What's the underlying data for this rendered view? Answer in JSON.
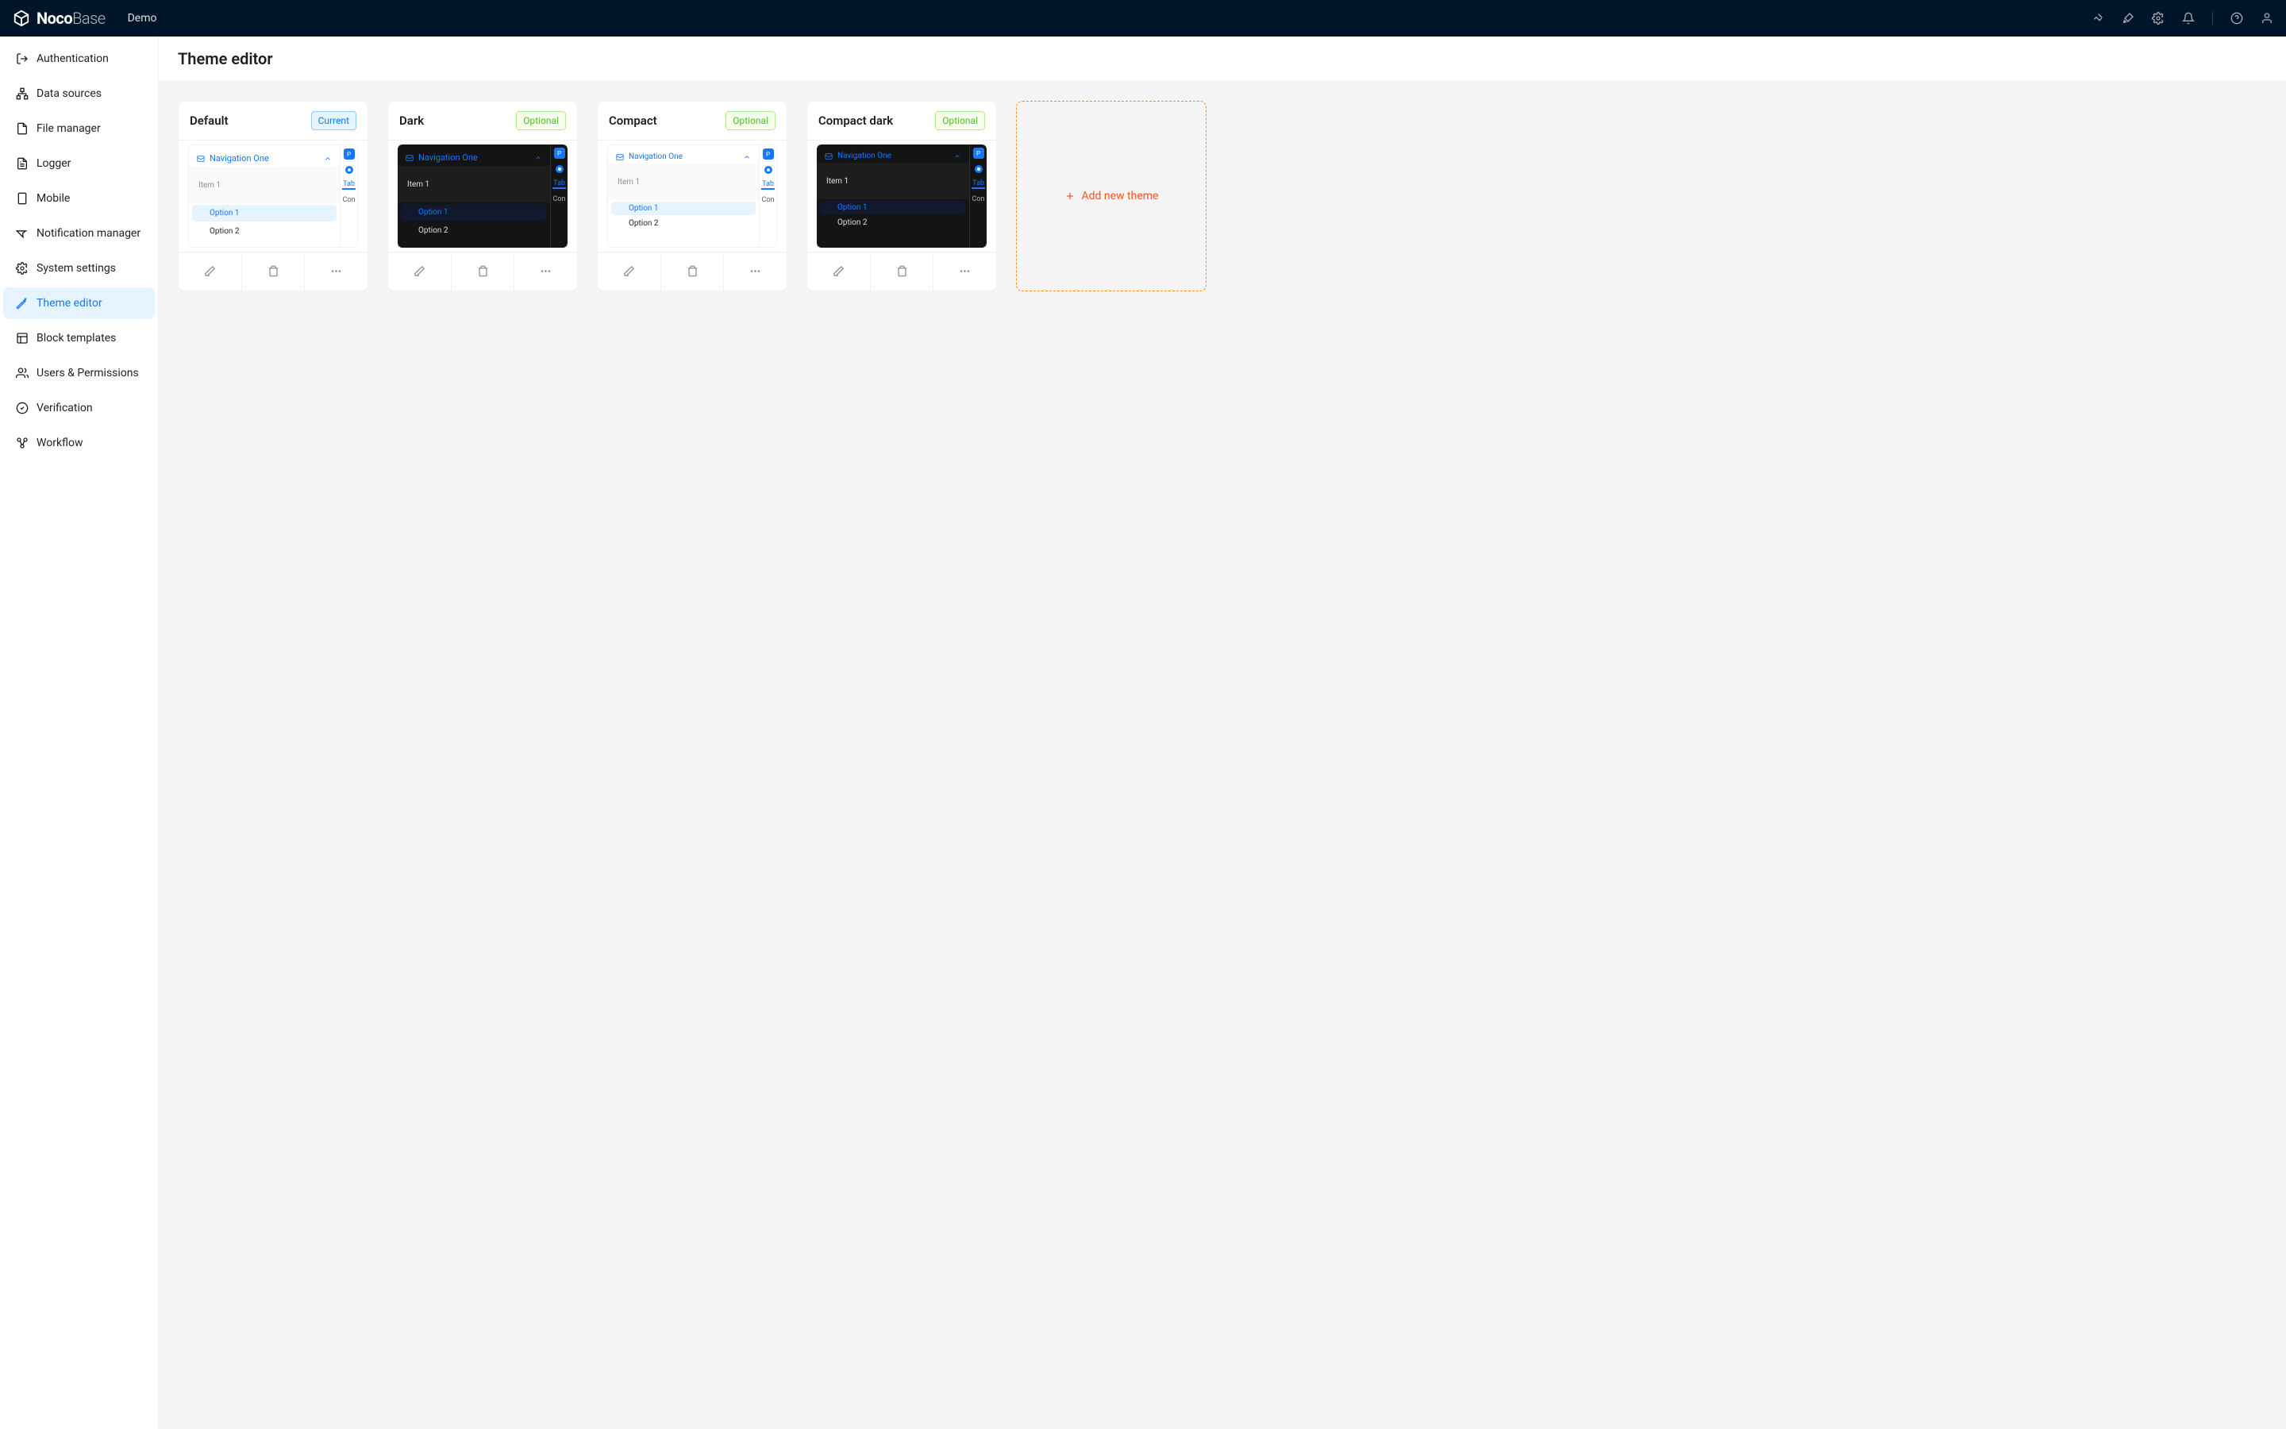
{
  "header": {
    "brand_bold": "Noco",
    "brand_thin": "Base",
    "link": "Demo"
  },
  "sidebar": {
    "items": [
      {
        "label": "Authentication",
        "icon": "logout-icon"
      },
      {
        "label": "Data sources",
        "icon": "cluster-icon"
      },
      {
        "label": "File manager",
        "icon": "file-icon"
      },
      {
        "label": "Logger",
        "icon": "file-text-icon"
      },
      {
        "label": "Mobile",
        "icon": "mobile-icon"
      },
      {
        "label": "Notification manager",
        "icon": "notification-icon"
      },
      {
        "label": "System settings",
        "icon": "gear-icon"
      },
      {
        "label": "Theme editor",
        "icon": "palette-icon",
        "active": true
      },
      {
        "label": "Block templates",
        "icon": "layout-icon"
      },
      {
        "label": "Users & Permissions",
        "icon": "users-icon"
      },
      {
        "label": "Verification",
        "icon": "check-circle-icon"
      },
      {
        "label": "Workflow",
        "icon": "share-icon"
      }
    ]
  },
  "page": {
    "title": "Theme editor"
  },
  "themes": [
    {
      "name": "Default",
      "status": "Current",
      "status_type": "current",
      "mode": "light",
      "compact": false
    },
    {
      "name": "Dark",
      "status": "Optional",
      "status_type": "optional",
      "mode": "dark",
      "compact": false
    },
    {
      "name": "Compact",
      "status": "Optional",
      "status_type": "optional",
      "mode": "light",
      "compact": true
    },
    {
      "name": "Compact dark",
      "status": "Optional",
      "status_type": "optional",
      "mode": "dark",
      "compact": true
    }
  ],
  "preview": {
    "nav": "Navigation One",
    "item1": "Item 1",
    "option1": "Option 1",
    "option2": "Option 2",
    "tab": "Tab",
    "con": "Con"
  },
  "add_new": "Add new theme"
}
